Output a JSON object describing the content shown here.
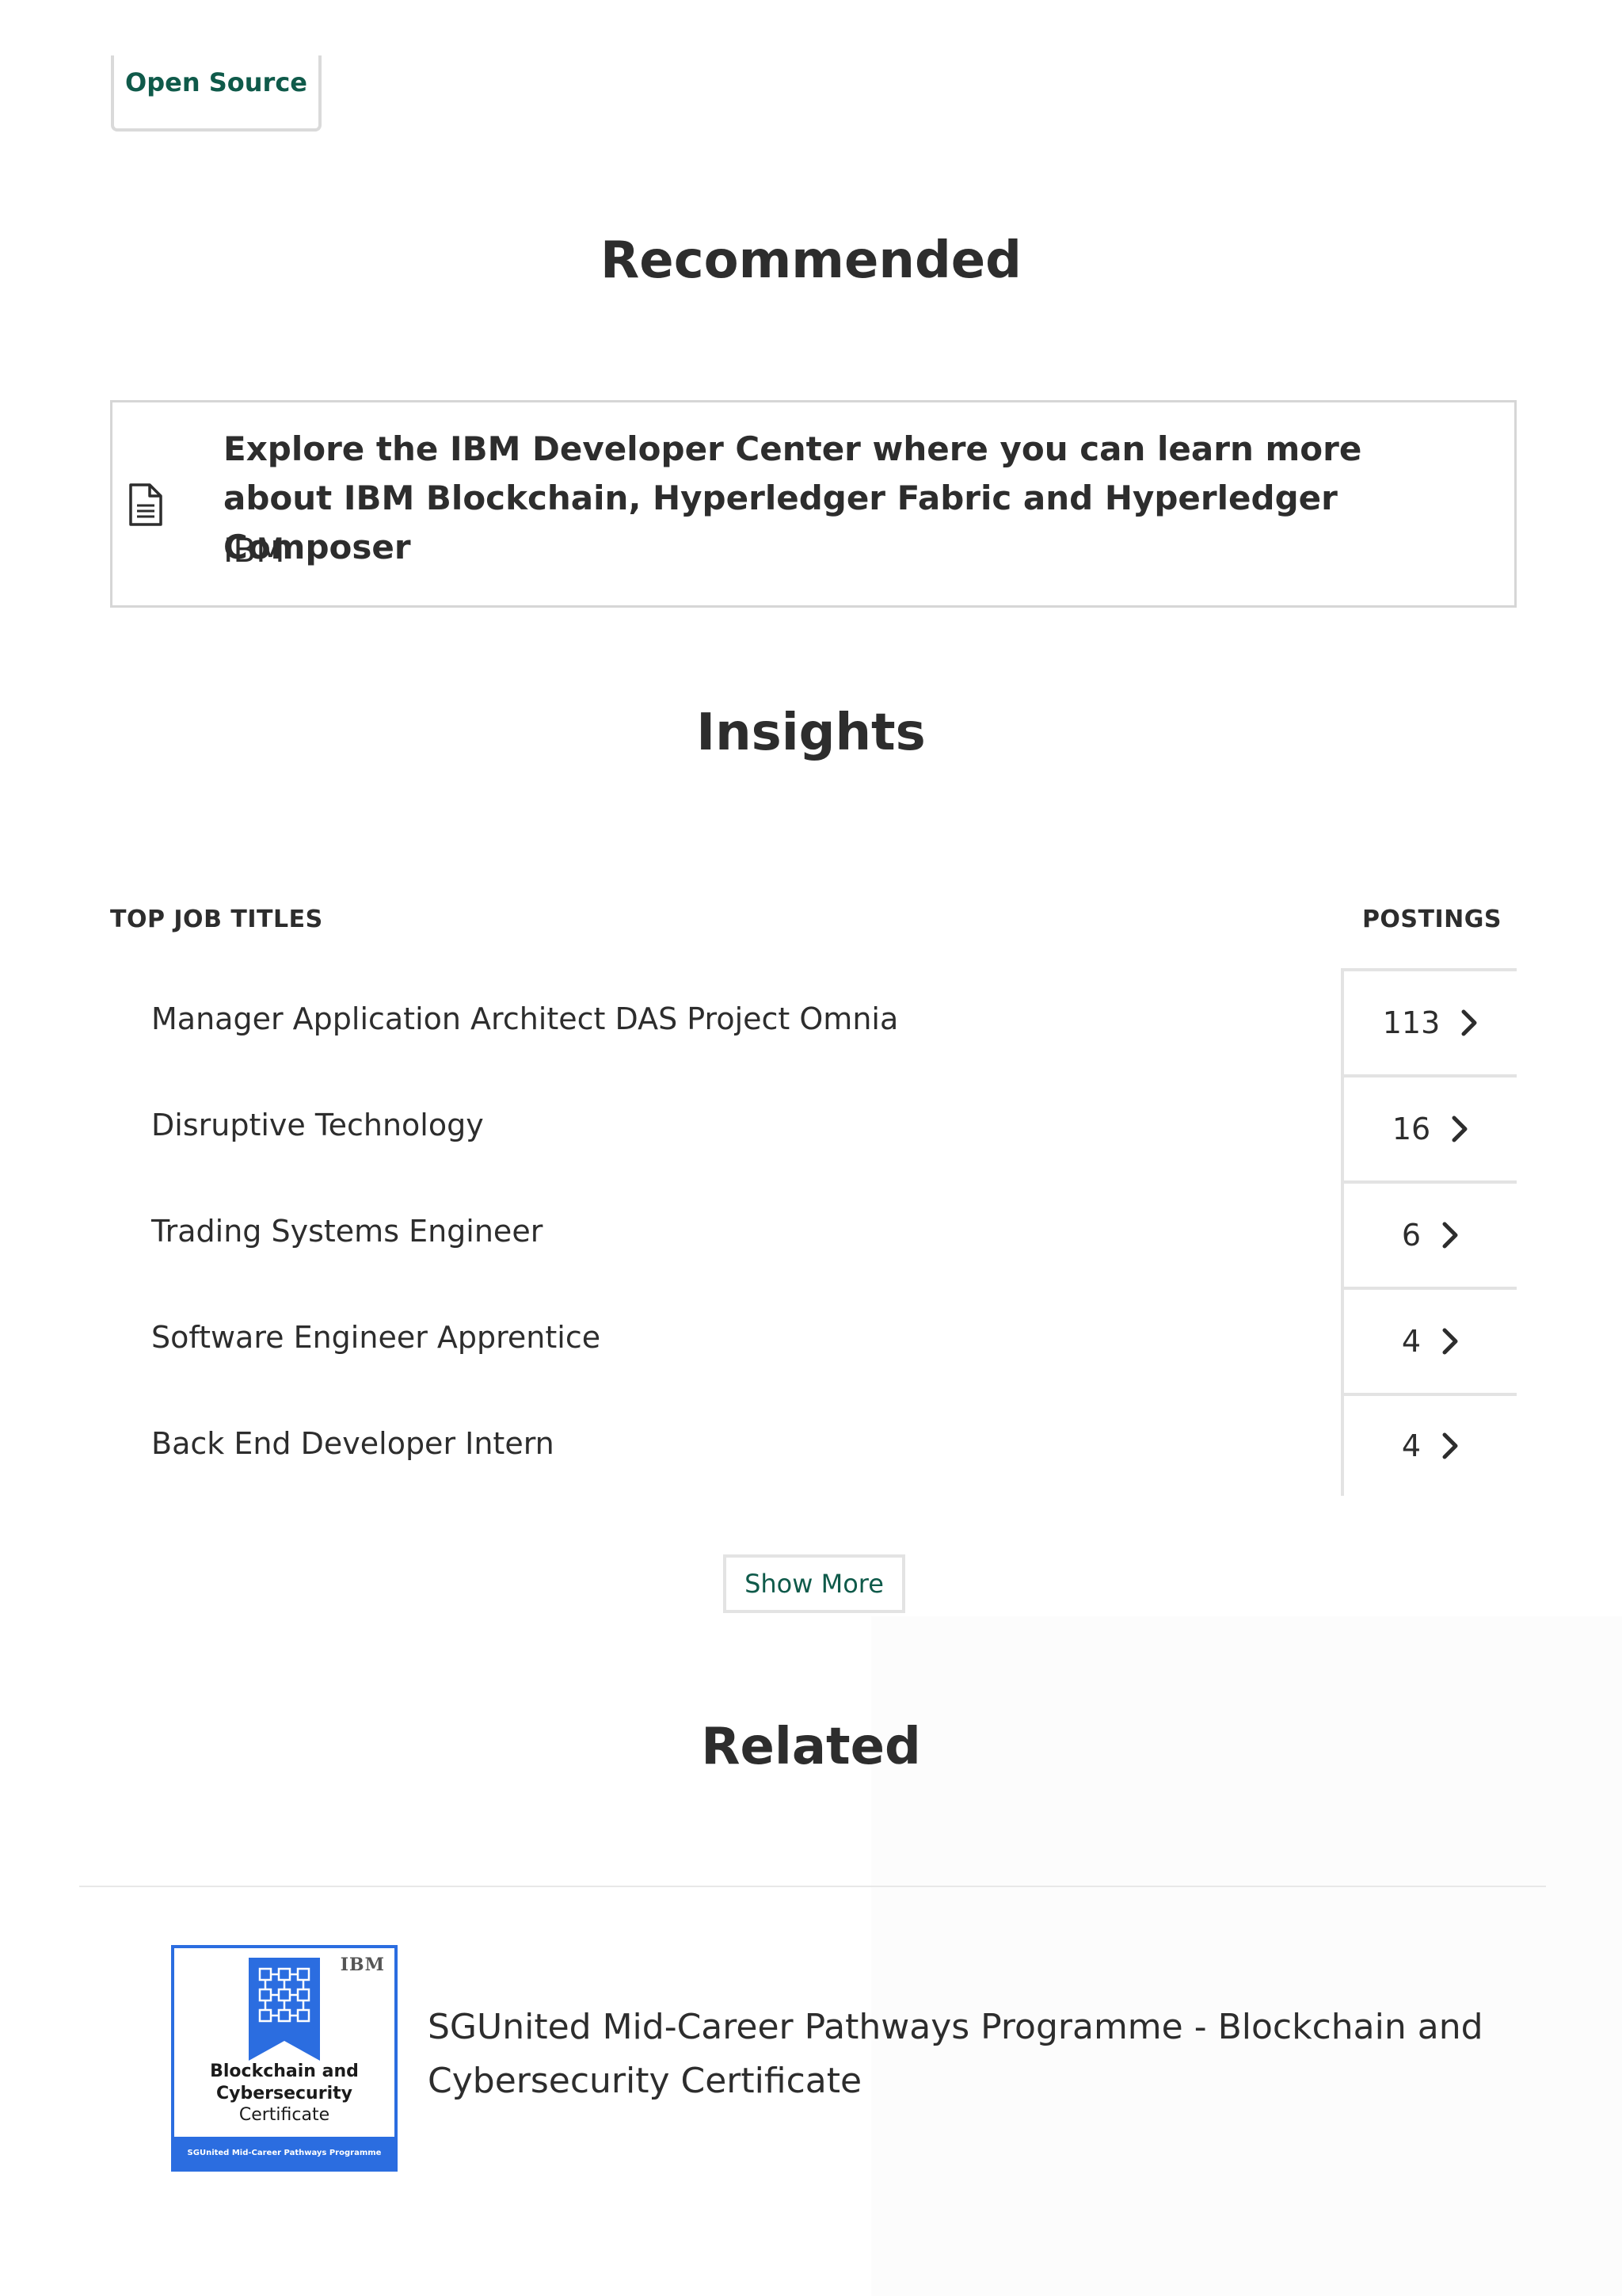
{
  "top_tag": {
    "label": "Open Source"
  },
  "sections": {
    "recommended": "Recommended",
    "insights": "Insights",
    "related": "Related"
  },
  "recommended": {
    "icon": "document-icon",
    "title": "Explore the IBM Developer Center where you can learn more about IBM Blockchain, Hyperledger Fabric and Hyperledger Composer",
    "source": "IBM"
  },
  "insights": {
    "col_title": "TOP JOB TITLES",
    "col_postings": "POSTINGS",
    "jobs": [
      {
        "title": "Manager Application Architect DAS Project Omnia",
        "postings": "113"
      },
      {
        "title": "Disruptive Technology",
        "postings": "16"
      },
      {
        "title": "Trading Systems Engineer",
        "postings": "6"
      },
      {
        "title": "Software Engineer Apprentice",
        "postings": "4"
      },
      {
        "title": "Back End Developer Intern",
        "postings": "4"
      }
    ],
    "show_more": "Show More"
  },
  "related": {
    "items": [
      {
        "title": "SGUnited Mid-Career Pathways Programme - Blockchain and Cybersecurity Certificate",
        "badge": {
          "brand": "IBM",
          "line1": "Blockchain and",
          "line2": "Cybersecurity",
          "line3": "Certificate",
          "footer": "SGUnited Mid-Career Pathways Programme",
          "color": "#2b6de0"
        }
      }
    ]
  },
  "colors": {
    "accent_green": "#0f5a4a",
    "text": "#2d2d2d",
    "badge_blue": "#2b6de0"
  }
}
